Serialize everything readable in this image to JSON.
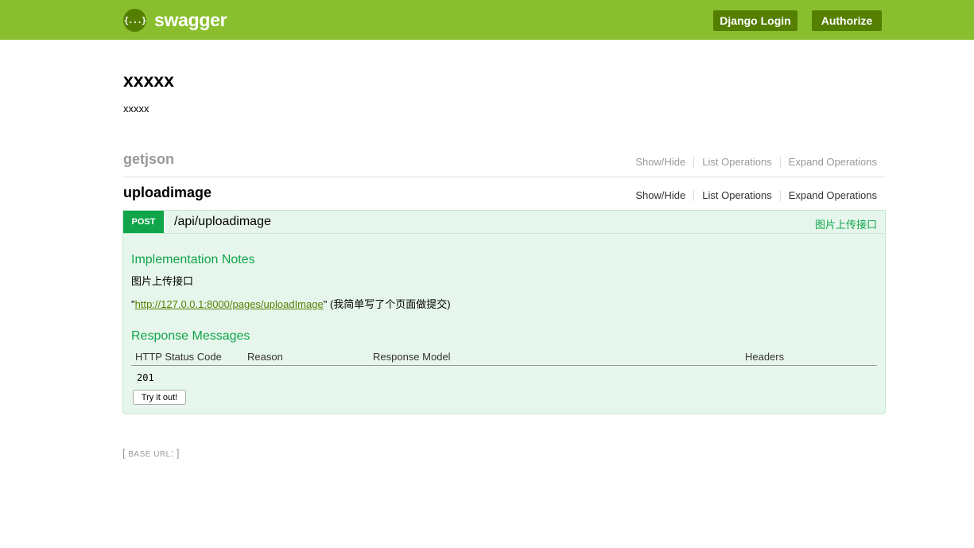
{
  "header": {
    "logo_icon": "{...}",
    "logo_text": "swagger",
    "django_login": "Django Login",
    "authorize": "Authorize"
  },
  "info": {
    "title": "xxxxx",
    "description": "xxxxx"
  },
  "resources": [
    {
      "name": "getjson",
      "show_hide": "Show/Hide",
      "list_operations": "List Operations",
      "expand_operations": "Expand Operations"
    },
    {
      "name": "uploadimage",
      "show_hide": "Show/Hide",
      "list_operations": "List Operations",
      "expand_operations": "Expand Operations"
    }
  ],
  "operation": {
    "method": "POST",
    "path": "/api/uploadimage",
    "summary": "图片上传接口",
    "implementation_notes_title": "Implementation Notes",
    "notes_line1": "图片上传接口",
    "notes_quote_open": "\"",
    "notes_link": "http://127.0.0.1:8000/pages/uploadImage",
    "notes_quote_close": "\"",
    "notes_suffix": " (我简单写了个页面做提交)",
    "response_messages_title": "Response Messages",
    "columns": [
      "HTTP Status Code",
      "Reason",
      "Response Model",
      "Headers"
    ],
    "responses": [
      {
        "code": "201"
      }
    ],
    "try_button": "Try it out!"
  },
  "base_url": {
    "open": "[ ",
    "label": "BASE URL",
    "close": ": ]"
  },
  "colors": {
    "header_bg": "#89bf2e",
    "header_button": "#547f00",
    "post_green": "#10a54a",
    "op_bg": "#e7f6ec"
  }
}
